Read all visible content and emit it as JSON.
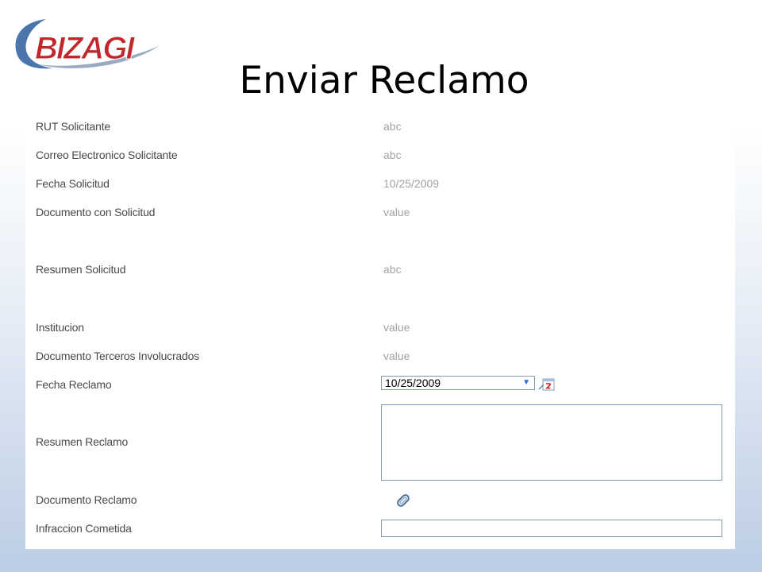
{
  "brand": {
    "logo_text": "BIZAGI"
  },
  "slide": {
    "title": "Enviar Reclamo"
  },
  "form": {
    "fields": [
      {
        "label": "RUT Solicitante",
        "value": "abc"
      },
      {
        "label": "Correo Electronico Solicitante",
        "value": "abc"
      },
      {
        "label": "Fecha Solicitud",
        "value": "10/25/2009"
      },
      {
        "label": "Documento con Solicitud",
        "value": "value"
      },
      {
        "label": "Resumen Solicitud",
        "value": "abc"
      },
      {
        "label": "Institucion",
        "value": "value"
      },
      {
        "label": "Documento Terceros Involucrados",
        "value": "value"
      },
      {
        "label": "Fecha Reclamo",
        "value": "10/25/2009"
      },
      {
        "label": "Resumen Reclamo",
        "value": ""
      },
      {
        "label": "Documento Reclamo",
        "value": ""
      },
      {
        "label": "Infraccion Cometida",
        "value": ""
      }
    ],
    "icons": {
      "date_dropdown": "chevron-down-icon",
      "calendar": "calendar-icon",
      "attachment": "paperclip-icon"
    }
  },
  "colors": {
    "logo_red": "#c0282d",
    "logo_blue": "#2a5d9f",
    "input_border": "#7f9db9",
    "label_text": "#4a4a4a",
    "readonly_value": "#a2a2a2"
  }
}
